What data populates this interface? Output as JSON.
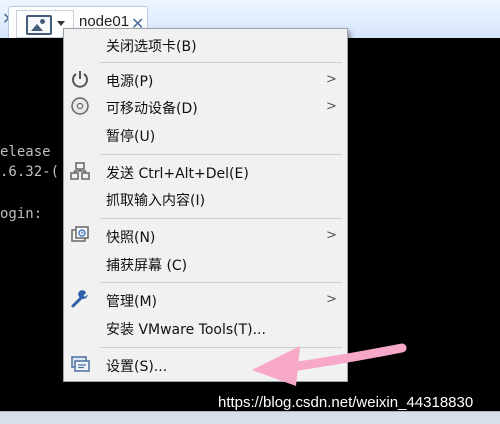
{
  "tab": {
    "title": "node01"
  },
  "console": {
    "lines": [
      "elease",
      ".6.32-(",
      "ogin:"
    ]
  },
  "menu": {
    "items": [
      {
        "label": "关闭选项卡(B)",
        "icon": "none",
        "submenu": false
      },
      {
        "label": "电源(P)",
        "icon": "power-icon",
        "submenu": true
      },
      {
        "label": "可移动设备(D)",
        "icon": "disc-icon",
        "submenu": true
      },
      {
        "label": "暂停(U)",
        "icon": "none",
        "submenu": false
      },
      {
        "label": "发送 Ctrl+Alt+Del(E)",
        "icon": "network-send-icon",
        "submenu": false
      },
      {
        "label": "抓取输入内容(I)",
        "icon": "none",
        "submenu": false
      },
      {
        "label": "快照(N)",
        "icon": "snapshot-icon",
        "submenu": true
      },
      {
        "label": "捕获屏幕 (C)",
        "icon": "none",
        "submenu": false
      },
      {
        "label": "管理(M)",
        "icon": "wrench-icon",
        "submenu": true
      },
      {
        "label": "安装 VMware Tools(T)...",
        "icon": "none",
        "submenu": false
      },
      {
        "label": "设置(S)...",
        "icon": "settings-icon",
        "submenu": false
      }
    ],
    "submenu_arrow": ">"
  },
  "watermark": "https://blog.csdn.net/weixin_44318830",
  "colors": {
    "menu_bg": "#f1f1f1",
    "annotation_arrow": "#f7a8c8",
    "console_bg": "#000000"
  }
}
